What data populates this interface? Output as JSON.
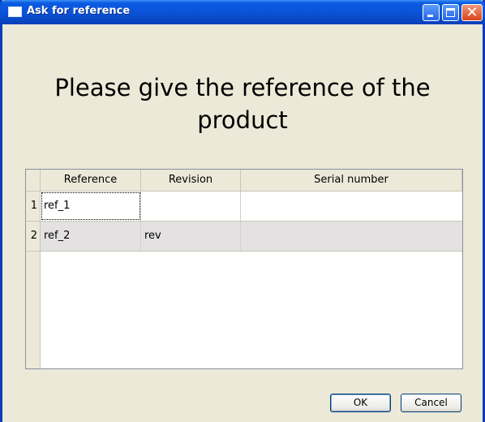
{
  "window": {
    "title": "Ask for reference",
    "app_icon": "window-icon",
    "controls": [
      "minimize",
      "maximize",
      "close"
    ]
  },
  "heading": "Please give the reference of the product",
  "table": {
    "columns": [
      "Reference",
      "Revision",
      "Serial number"
    ],
    "rows": [
      {
        "num": "1",
        "reference": "ref_1",
        "revision": "",
        "serial": ""
      },
      {
        "num": "2",
        "reference": "ref_2",
        "revision": "rev",
        "serial": ""
      }
    ]
  },
  "buttons": {
    "ok": "OK",
    "cancel": "Cancel"
  },
  "colors": {
    "titlebar": "#0a52d6",
    "dialog_bg": "#ece9d8",
    "close_button": "#d8421a",
    "alt_row": "#e3e1e1"
  }
}
